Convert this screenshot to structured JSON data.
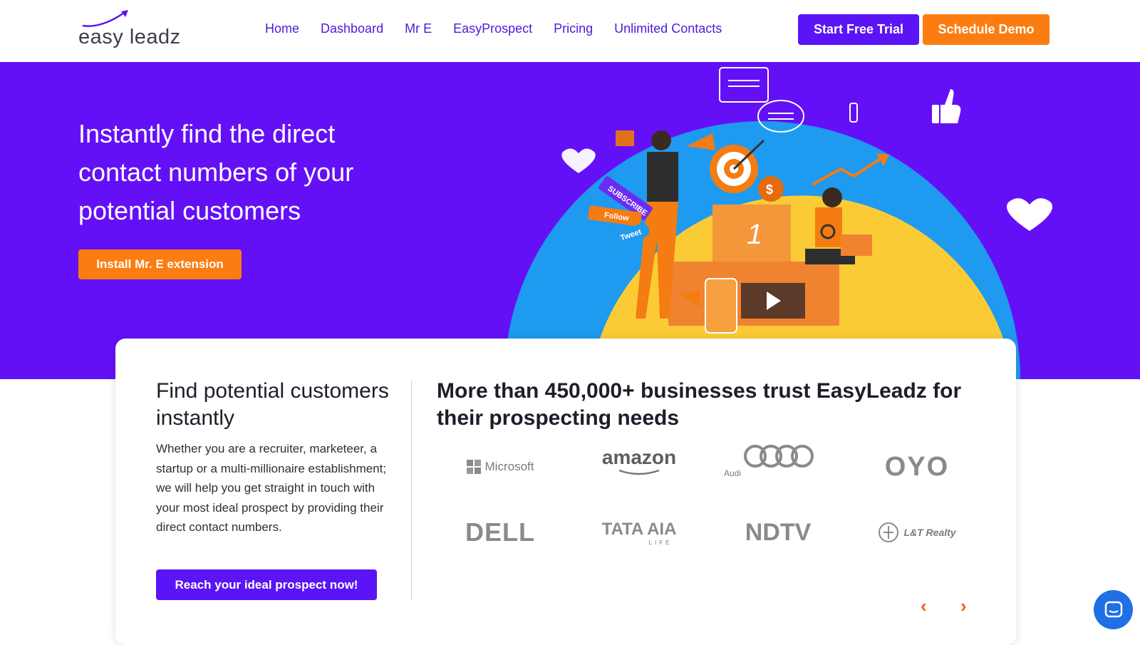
{
  "brand": {
    "logo_text": "easy leadz"
  },
  "nav": {
    "items": [
      "Home",
      "Dashboard",
      "Mr E",
      "EasyProspect",
      "Pricing",
      "Unlimited Contacts"
    ]
  },
  "header_buttons": {
    "trial": "Start Free Trial",
    "demo": "Schedule Demo"
  },
  "hero": {
    "title": "Instantly find the direct contact numbers of your potential customers",
    "install_button": "Install Mr. E extension",
    "illustration_tags": {
      "subscribe": "SUBSCRIBE",
      "follow": "Follow",
      "tweet": "Tweet",
      "podium": "1",
      "money": "$"
    }
  },
  "card": {
    "heading": "Find potential customers instantly",
    "body": "Whether you are a recruiter, marketeer, a startup or a multi-millionaire establishment; we will help you get straight in touch with your most ideal prospect by providing their direct contact numbers.",
    "cta": "Reach your ideal prospect now!",
    "trust_heading": "More than 450,000+ businesses trust EasyLeadz for their prospecting needs",
    "logos": [
      "Microsoft",
      "amazon",
      "Audi",
      "OYO",
      "DELL",
      "TATA AIA",
      "NDTV",
      "L&T Realty"
    ],
    "tata_sub": "LIFE",
    "prev_arrow": "‹",
    "next_arrow": "›"
  },
  "colors": {
    "primary": "#6410f7",
    "button_purple": "#5a14f5",
    "accent": "#fb7d12",
    "chat": "#1f6fe5"
  }
}
